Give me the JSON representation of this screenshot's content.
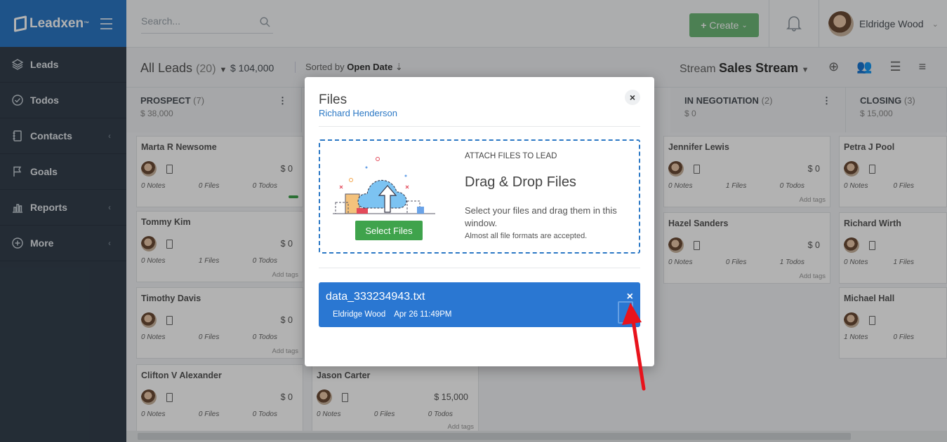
{
  "app": {
    "brand": "Leadxen",
    "brand_tm": "™"
  },
  "sidebar": {
    "items": [
      {
        "label": "Leads",
        "icon": "layers-icon"
      },
      {
        "label": "Todos",
        "icon": "check-circle-icon"
      },
      {
        "label": "Contacts",
        "icon": "address-book-icon"
      },
      {
        "label": "Goals",
        "icon": "flag-icon"
      },
      {
        "label": "Reports",
        "icon": "bar-chart-icon"
      },
      {
        "label": "More",
        "icon": "plus-circle-icon"
      }
    ]
  },
  "topbar": {
    "search_placeholder": "Search...",
    "create_label": "Create",
    "user_name": "Eldridge Wood"
  },
  "subbar": {
    "title": "All Leads",
    "count": "(20)",
    "amount": "$ 104,000",
    "sorted_prefix": "Sorted by",
    "sorted_field": "Open Date",
    "stream_prefix": "Stream",
    "stream_name": "Sales Stream"
  },
  "columns": [
    {
      "title": "PROSPECT",
      "count": "(7)",
      "amount": "$ 38,000"
    },
    {
      "title": "IN NEGOTIATION",
      "count": "(2)",
      "amount": "$ 0"
    },
    {
      "title": "CLOSING",
      "count": "(3)",
      "amount": "$ 15,000"
    }
  ],
  "cards": {
    "c1": {
      "name": "Marta R Newsome",
      "value": "$ 0",
      "notes": "0 Notes",
      "files": "0 Files",
      "todos": "0 Todos"
    },
    "c2": {
      "name": "Tommy Kim",
      "value": "$ 0",
      "notes": "0 Notes",
      "files": "1 Files",
      "todos": "0 Todos",
      "tags": "Add tags"
    },
    "c3": {
      "name": "Timothy Davis",
      "value": "$ 0",
      "notes": "0 Notes",
      "files": "0 Files",
      "todos": "0 Todos",
      "tags": "Add tags"
    },
    "c4": {
      "name": "Clifton V Alexander",
      "value": "$ 0",
      "notes": "0 Notes",
      "files": "0 Files",
      "todos": "0 Todos"
    },
    "c5": {
      "name": "Jason Carter",
      "value": "$ 15,000",
      "notes": "0 Notes",
      "files": "0 Files",
      "todos": "0 Todos",
      "tags": "Add tags"
    },
    "c6": {
      "name": "Jennifer Lewis",
      "value": "$ 0",
      "notes": "0 Notes",
      "files": "1 Files",
      "todos": "0 Todos",
      "tags": "Add tags"
    },
    "c7": {
      "name": "Hazel Sanders",
      "value": "$ 0",
      "notes": "0 Notes",
      "files": "0 Files",
      "todos": "1 Todos",
      "tags": "Add tags"
    },
    "c8": {
      "name": "Petra J Pool",
      "notes": "0 Notes",
      "files": "0 Files"
    },
    "c9": {
      "name": "Richard Wirth",
      "notes": "0 Notes",
      "files": "1 Files"
    },
    "c10": {
      "name": "Michael Hall",
      "notes": "1 Notes",
      "files": "0 Files"
    }
  },
  "modal": {
    "title": "Files",
    "subtitle": "Richard Henderson",
    "close": "×",
    "attach_heading": "ATTACH FILES TO LEAD",
    "drop_title": "Drag & Drop Files",
    "drop_desc": "Select your files and drag them in this window.",
    "drop_formats": "Almost all file formats are accepted.",
    "select_label": "Select Files",
    "file": {
      "name": "data_333234943.txt",
      "uploader": "Eldridge Wood",
      "date": "Apr 26 11:49PM",
      "remove": "×"
    }
  },
  "colors": {
    "brand": "#2b78c5",
    "sidebar": "#34404d",
    "green": "#3fa34c",
    "file_bg": "#2a77d2",
    "arrow": "#e8131c"
  }
}
